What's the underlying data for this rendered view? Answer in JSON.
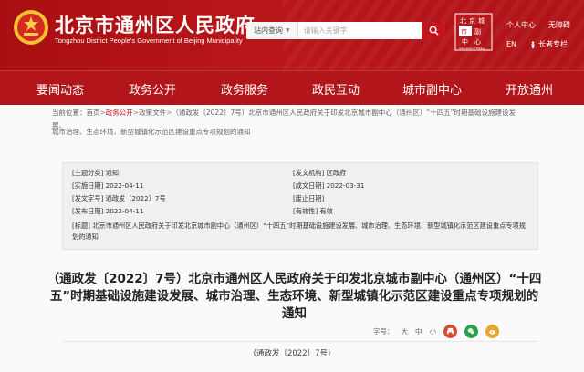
{
  "header": {
    "site_title": "北京市通州区人民政府",
    "site_subtitle": "Tongzhou District People's Government of Beijing Municipality",
    "search": {
      "scope_label": "站内查询",
      "placeholder": "请输入关键字"
    },
    "logo_text": [
      "北",
      "京",
      "城",
      "市",
      "副",
      "中",
      "心"
    ],
    "logo_caption": "Sub-center of Beijing",
    "user_center": "个人中心",
    "accessibility": "无障碍",
    "elderly_mode": "长者专栏",
    "language": "EN",
    "brand_color": "#b2161a"
  },
  "nav": {
    "items": [
      "要闻动态",
      "政务公开",
      "政务服务",
      "政民互动",
      "城市副中心",
      "开放通州"
    ]
  },
  "breadcrumb": {
    "label": "当前位置：",
    "home": "首页",
    "level1": "政务公开",
    "level2": "政策文件",
    "current_part1": "（通政发〔2022〕7号）北京市通州区人民政府关于印发北京城市副中心（通州区）“十四五”时期基础设施建设发展、",
    "current_part2": "城市治理、生态环境、新型城镇化示范区建设重点专项规划的通知"
  },
  "meta": {
    "topic": "[主题分类] 通知",
    "issuer": "[发文机构] 区政府",
    "effective_date": "[实施日期] 2022-04-11",
    "written_date": "[成文日期] 2022-03-31",
    "doc_number": "[发文字号] 通政发〔2022〕7号",
    "repeal_date": "[废止日期]",
    "publish_date": "[发布日期] 2022-04-11",
    "validity": "[有效性] 有效",
    "title_line": "[标题] 北京市通州区人民政府关于印发北京城市副中心（通州区）“十四五”时期基础设施建设发展、城市治理、生态环境、新型城镇化示范区建设重点专项规划的通知"
  },
  "document": {
    "title": "（通政发〔2022〕7号）北京市通州区人民政府关于印发北京城市副中心（通州区）“十四五”时期基础设施建设发展、城市治理、生态环境、新型城镇化示范区建设重点专项规划的通知",
    "doc_number_line": "(通政发〔2022〕7号)"
  },
  "tools": {
    "font_label": "字号：",
    "large": "大",
    "medium": "中",
    "small": "小",
    "print_icon_color": "#d84a36",
    "share_icon_color": "#2aa14a",
    "weibo_icon_color": "#e8a62e"
  }
}
